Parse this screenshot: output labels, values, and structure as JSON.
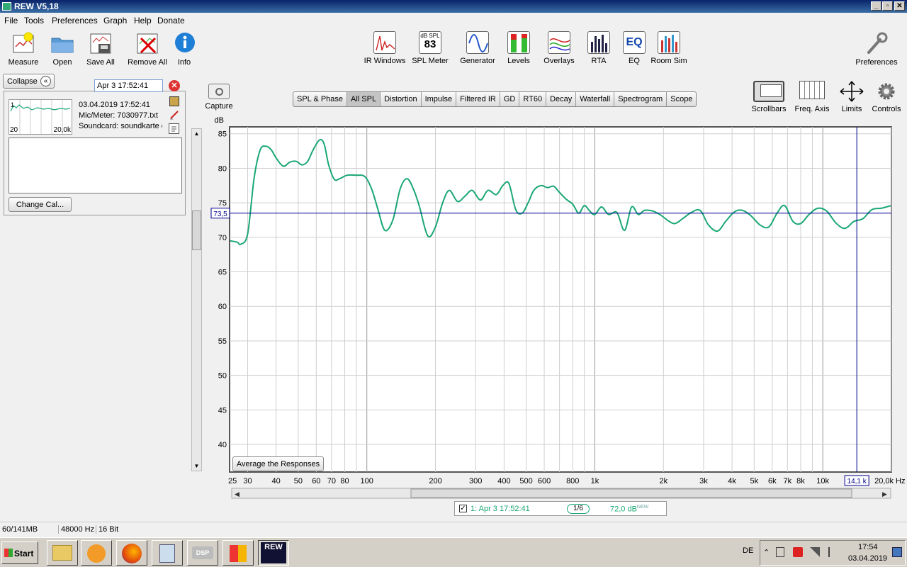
{
  "window": {
    "title": "REW V5,18"
  },
  "menu": [
    "File",
    "Tools",
    "Preferences",
    "Graph",
    "Help",
    "Donate"
  ],
  "toolbar_left": [
    "Measure",
    "Open",
    "Save All",
    "Remove All",
    "Info"
  ],
  "toolbar_center": [
    {
      "label": "IR Windows"
    },
    {
      "label": "SPL Meter",
      "top": "dB SPL",
      "value": "83"
    },
    {
      "label": "Generator"
    },
    {
      "label": "Levels"
    },
    {
      "label": "Overlays"
    },
    {
      "label": "RTA"
    },
    {
      "label": "EQ",
      "icon_text": "EQ"
    },
    {
      "label": "Room Sim"
    }
  ],
  "toolbar_right": {
    "preferences": "Preferences"
  },
  "capture": "Capture",
  "graph_tools": [
    "Scrollbars",
    "Freq. Axis",
    "Limits",
    "Controls"
  ],
  "left_panel": {
    "collapse": "Collapse",
    "collapse_icon": "«",
    "measurement_name": "Apr 3 17:52:41",
    "thumb_left": "20",
    "thumb_right": "20,0k",
    "thumb_index": "1",
    "date": "03.04.2019 17:52:41",
    "mic": "Mic/Meter: 7030977.txt",
    "soundcard": "Soundcard: soundkarte c",
    "change_cal": "Change Cal..."
  },
  "tabs": [
    {
      "label": "SPL & Phase",
      "active": false
    },
    {
      "label": "All SPL",
      "active": true
    },
    {
      "label": "Distortion",
      "active": false
    },
    {
      "label": "Impulse",
      "active": false
    },
    {
      "label": "Filtered IR",
      "active": false
    },
    {
      "label": "GD",
      "active": false
    },
    {
      "label": "RT60",
      "active": false
    },
    {
      "label": "Decay",
      "active": false
    },
    {
      "label": "Waterfall",
      "active": false
    },
    {
      "label": "Spectrogram",
      "active": false
    },
    {
      "label": "Scope",
      "active": false
    }
  ],
  "graph": {
    "y_unit": "dB",
    "x_unit": "Hz",
    "y_ticks": [
      "85",
      "80",
      "75",
      "70",
      "65",
      "60",
      "55",
      "50",
      "45",
      "40"
    ],
    "x_ticks": [
      "25",
      "30",
      "40",
      "50",
      "60",
      "70",
      "80",
      "100",
      "200",
      "300",
      "400",
      "500",
      "600",
      "800",
      "1k",
      "2k",
      "3k",
      "4k",
      "5k",
      "6k",
      "7k",
      "8k",
      "10k",
      "20,0k"
    ],
    "cursor_y_label": "73,5",
    "cursor_x_label": "14,1 k",
    "average_button": "Average the Responses",
    "curve_color": "#1aa773",
    "cursor_color": "#00008b"
  },
  "chart_data": {
    "type": "line",
    "x_scale": "log",
    "xlim": [
      25,
      20000
    ],
    "ylim": [
      36,
      86
    ],
    "ylabel": "dB",
    "xlabel": "Hz",
    "series": [
      {
        "name": "1: Apr 3 17:52:41",
        "x": [
          25,
          27,
          28,
          30,
          32,
          34,
          36,
          38,
          40,
          43,
          46,
          49,
          52,
          55,
          58,
          62,
          65,
          68,
          72,
          76,
          82,
          90,
          98,
          105,
          112,
          120,
          130,
          140,
          150,
          160,
          170,
          185,
          200,
          215,
          230,
          250,
          270,
          290,
          315,
          340,
          370,
          395,
          420,
          450,
          480,
          510,
          540,
          580,
          620,
          660,
          700,
          750,
          800,
          850,
          900,
          950,
          1000,
          1070,
          1150,
          1250,
          1350,
          1450,
          1550,
          1650,
          1800,
          1950,
          2100,
          2250,
          2450,
          2650,
          2900,
          3150,
          3450,
          3750,
          4100,
          4450,
          4850,
          5300,
          5800,
          6300,
          6800,
          7400,
          8000,
          8700,
          9500,
          10400,
          11400,
          12500,
          13700,
          15000,
          16400,
          18000,
          19000,
          20000
        ],
        "y": [
          69.5,
          69.3,
          69.0,
          70.5,
          78.5,
          82.6,
          83.2,
          82.7,
          81.5,
          80.3,
          80.9,
          81.0,
          80.5,
          81.0,
          82.6,
          84.1,
          83.5,
          80.5,
          78.4,
          78.5,
          79.0,
          79.0,
          78.8,
          77.0,
          74.0,
          71.0,
          72.5,
          77.0,
          78.5,
          77.0,
          74.5,
          70.2,
          71.5,
          75.0,
          76.8,
          75.2,
          76.0,
          76.8,
          75.4,
          76.8,
          76.2,
          77.5,
          77.8,
          74.0,
          73.5,
          75.0,
          76.8,
          77.5,
          77.2,
          77.4,
          76.5,
          75.5,
          74.8,
          73.5,
          74.6,
          73.8,
          73.3,
          74.4,
          73.3,
          73.6,
          71.0,
          74.4,
          73.3,
          73.9,
          73.8,
          73.2,
          72.4,
          72.0,
          72.8,
          73.6,
          73.9,
          71.8,
          70.9,
          72.3,
          73.7,
          73.9,
          73.1,
          71.8,
          71.5,
          73.5,
          74.6,
          72.3,
          72.0,
          73.3,
          74.2,
          73.8,
          72.1,
          71.3,
          72.3,
          72.7,
          74.0,
          74.2,
          74.4,
          74.6
        ]
      }
    ],
    "cursor": {
      "y": 73.5,
      "x": 14100
    },
    "grid": true,
    "legend": "bottom"
  },
  "legend_bar": {
    "label": "1: Apr 3 17:52:41",
    "smoothing": "1/6",
    "level": "72,0 dB",
    "level_tag": "NEW"
  },
  "statusbar": {
    "memory": "60/141MB",
    "rate": "48000 Hz",
    "bits": "16 Bit"
  },
  "taskbar": {
    "start": "Start",
    "lang": "DE",
    "time": "17:54",
    "date": "03.04.2019",
    "rew_task": "REW"
  }
}
